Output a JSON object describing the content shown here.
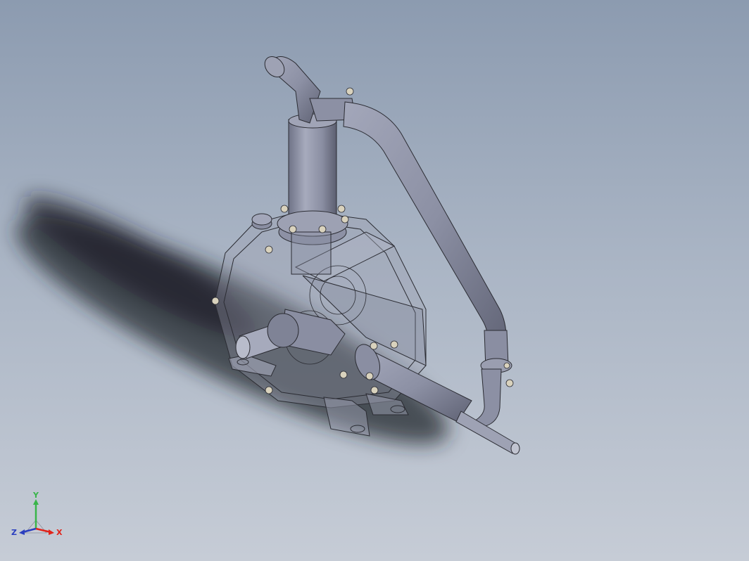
{
  "viewport": {
    "background_top": "#8c9bb0",
    "background_bottom": "#c6ccd6",
    "model_color": "#8a8ea2",
    "edge_color": "#2b2c33"
  },
  "triad": {
    "y_label": "Y",
    "x_label": "X",
    "z_label": "Z",
    "y_color": "#39b54a",
    "x_color": "#e0241b",
    "z_color": "#2b3fbf"
  }
}
